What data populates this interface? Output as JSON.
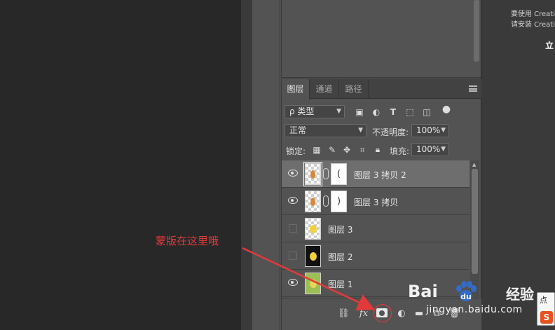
{
  "creative_cloud": {
    "line1": "要使用 Creati",
    "line2": "请安装 Creati",
    "action": "立"
  },
  "layers_panel": {
    "tabs": [
      {
        "label": "图层",
        "active": true
      },
      {
        "label": "通道",
        "active": false
      },
      {
        "label": "路径",
        "active": false
      }
    ],
    "filter": {
      "label": "ρ 类型"
    },
    "blend_mode": "正常",
    "opacity_label": "不透明度:",
    "opacity_value": "100%",
    "lock_label": "锁定:",
    "fill_label": "填充:",
    "fill_value": "100%",
    "layers": [
      {
        "name": "图层 3 拷贝 2",
        "visible": true,
        "selected": true,
        "has_mask": true,
        "mask_glyph": "("
      },
      {
        "name": "图层 3 拷贝",
        "visible": true,
        "selected": false,
        "has_mask": true,
        "mask_glyph": ")"
      },
      {
        "name": "图层 3",
        "visible": false,
        "selected": false,
        "has_mask": false
      },
      {
        "name": "图层 2",
        "visible": false,
        "selected": false,
        "has_mask": false
      },
      {
        "name": "图层 1",
        "visible": true,
        "selected": false,
        "has_mask": false
      }
    ]
  },
  "annotation": {
    "text": "蒙版在这里哦",
    "color": "#e23a3a"
  },
  "watermark": {
    "brand_left": "Bai",
    "brand_right": "du",
    "brand_cn": "经验",
    "url": "jingyan.baidu.com"
  },
  "badge": {
    "text": "点"
  },
  "colors": {
    "canvas": "#282828",
    "panel": "#535353",
    "selected_row": "#6e6e6e",
    "accent_red": "#e23a3a"
  }
}
